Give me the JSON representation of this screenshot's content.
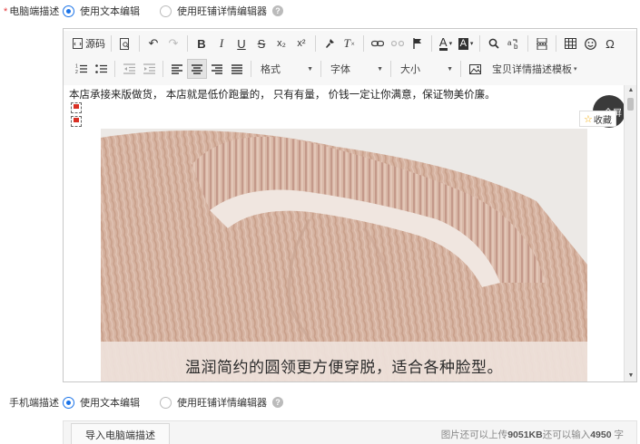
{
  "pc_desc": {
    "required_mark": "*",
    "label": "电脑端描述",
    "options": [
      {
        "label": "使用文本编辑",
        "selected": true
      },
      {
        "label": "使用旺铺详情编辑器",
        "selected": false
      }
    ]
  },
  "mobile_desc": {
    "label": "手机端描述",
    "options": [
      {
        "label": "使用文本编辑",
        "selected": true
      },
      {
        "label": "使用旺铺详情编辑器",
        "selected": false
      }
    ]
  },
  "help_glyph": "?",
  "toolbar": {
    "source_label": "源码",
    "format_label": "格式",
    "font_label": "字体",
    "size_label": "大小",
    "template_label": "宝贝详情描述模板",
    "icons": {
      "bold": "B",
      "italic": "I",
      "underline": "U",
      "strike": "S",
      "sub": "x₂",
      "sup": "x²",
      "clear": "T",
      "omega": "Ω",
      "font_color": "A",
      "bg_color": "A"
    }
  },
  "content": {
    "intro": "本店承接来版做货， 本店就是低价跑量的， 只有有量， 价钱一定让你满意，保证物美价廉。",
    "caption": "温润简约的圆领更方便穿脱，适合各种脸型。",
    "fullscreen_label": "全屏",
    "favorite_label": "收藏"
  },
  "footer": {
    "import_label": "导入电脑端描述",
    "quota_prefix": "图片还可以上传",
    "quota_kb": "9051KB",
    "quota_mid": "还可以输入",
    "quota_chars": "4950",
    "quota_suffix": " 字"
  },
  "colors": {
    "accent": "#1a73e8",
    "required": "#e4393c"
  }
}
